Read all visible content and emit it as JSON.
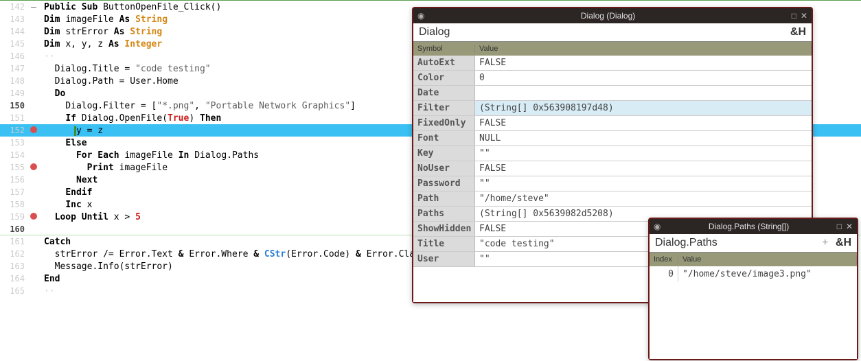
{
  "editor": {
    "lines": [
      {
        "n": "142",
        "mark": "minus",
        "tokens": [
          [
            "Public ",
            "kw-dark"
          ],
          [
            "Sub ",
            "kw-dark"
          ],
          [
            "ButtonOpenFile_Click",
            ""
          ],
          [
            "()",
            ""
          ]
        ]
      },
      {
        "n": "143",
        "tokens": [
          [
            "Dim ",
            "kw-dark"
          ],
          [
            "imageFile ",
            ""
          ],
          [
            "As ",
            "kw-dark"
          ],
          [
            "String",
            "kw-orange"
          ]
        ]
      },
      {
        "n": "144",
        "tokens": [
          [
            "Dim ",
            "kw-dark"
          ],
          [
            "strError ",
            ""
          ],
          [
            "As ",
            "kw-dark"
          ],
          [
            "String",
            "kw-orange"
          ]
        ]
      },
      {
        "n": "145",
        "tokens": [
          [
            "Dim ",
            "kw-dark"
          ],
          [
            "x, y, z ",
            ""
          ],
          [
            "As ",
            "kw-dark"
          ],
          [
            "Integer",
            "kw-orange"
          ]
        ]
      },
      {
        "n": "146",
        "tokens": [
          [
            "··",
            "dots"
          ]
        ]
      },
      {
        "n": "147",
        "tokens": [
          [
            "  Dialog.Title = ",
            ""
          ],
          [
            "\"code testing\"",
            "str"
          ]
        ]
      },
      {
        "n": "148",
        "tokens": [
          [
            "  Dialog.Path = User.Home",
            ""
          ]
        ]
      },
      {
        "n": "149",
        "tokens": [
          [
            "  ",
            ""
          ],
          [
            "Do",
            "kw-dark"
          ]
        ]
      },
      {
        "n": "150",
        "current": true,
        "tokens": [
          [
            "    Dialog.Filter = [",
            ""
          ],
          [
            "\"*.png\"",
            "str"
          ],
          [
            ", ",
            ""
          ],
          [
            "\"Portable Network Graphics\"",
            "str"
          ],
          [
            "]",
            ""
          ]
        ]
      },
      {
        "n": "151",
        "tokens": [
          [
            "    ",
            ""
          ],
          [
            "If ",
            "kw-dark"
          ],
          [
            "Dialog.OpenFile(",
            ""
          ],
          [
            "True",
            "kw-red"
          ],
          [
            ") ",
            ""
          ],
          [
            "Then",
            "kw-dark"
          ]
        ]
      },
      {
        "n": "152",
        "mark": "bp",
        "hl": true,
        "tokens": [
          [
            "      y = z",
            ""
          ]
        ]
      },
      {
        "n": "153",
        "tokens": [
          [
            "    ",
            ""
          ],
          [
            "Else",
            "kw-dark"
          ]
        ]
      },
      {
        "n": "154",
        "tokens": [
          [
            "      ",
            ""
          ],
          [
            "For Each ",
            "kw-dark"
          ],
          [
            "imageFile ",
            ""
          ],
          [
            "In ",
            "kw-dark"
          ],
          [
            "Dialog.Paths",
            ""
          ]
        ]
      },
      {
        "n": "155",
        "mark": "bp",
        "tokens": [
          [
            "        ",
            ""
          ],
          [
            "Print ",
            "kw-dark"
          ],
          [
            "imageFile",
            ""
          ]
        ]
      },
      {
        "n": "156",
        "tokens": [
          [
            "      ",
            ""
          ],
          [
            "Next",
            "kw-dark"
          ]
        ]
      },
      {
        "n": "157",
        "tokens": [
          [
            "    ",
            ""
          ],
          [
            "Endif",
            "kw-dark"
          ]
        ]
      },
      {
        "n": "158",
        "tokens": [
          [
            "    ",
            ""
          ],
          [
            "Inc ",
            "kw-dark"
          ],
          [
            "x",
            ""
          ]
        ]
      },
      {
        "n": "159",
        "mark": "bp",
        "tokens": [
          [
            "  ",
            ""
          ],
          [
            "Loop Until ",
            "kw-dark"
          ],
          [
            "x > ",
            ""
          ],
          [
            "5",
            "num"
          ]
        ]
      },
      {
        "n": "160",
        "current": true,
        "tokens": [
          [
            "",
            ""
          ]
        ],
        "border": true
      },
      {
        "n": "161",
        "tokens": [
          [
            "Catch",
            "kw-dark"
          ]
        ]
      },
      {
        "n": "162",
        "tokens": [
          [
            "  strError /= Error.Text ",
            ""
          ],
          [
            "& ",
            "kw-dark"
          ],
          [
            "Error.Where ",
            ""
          ],
          [
            "& ",
            "kw-dark"
          ],
          [
            "CStr",
            "kw-blue"
          ],
          [
            "(Error.Code) ",
            ""
          ],
          [
            "& ",
            "kw-dark"
          ],
          [
            "Error.Class.Name",
            ""
          ]
        ]
      },
      {
        "n": "163",
        "tokens": [
          [
            "  Message.Info(strError)",
            ""
          ]
        ]
      },
      {
        "n": "164",
        "tokens": [
          [
            "End",
            "kw-dark"
          ]
        ]
      },
      {
        "n": "165",
        "tokens": [
          [
            "··",
            "dots"
          ]
        ]
      }
    ]
  },
  "dialogWin": {
    "title": "Dialog (Dialog)",
    "subtitle": "Dialog",
    "hexBtn": "&H",
    "head": {
      "col1": "Symbol",
      "col2": "Value"
    },
    "rows": [
      {
        "k": "AutoExt",
        "v": "FALSE"
      },
      {
        "k": "Color",
        "v": "0"
      },
      {
        "k": "Date",
        "v": ""
      },
      {
        "k": "Filter",
        "v": "(String[] 0x563908197d48)",
        "sel": true
      },
      {
        "k": "FixedOnly",
        "v": "FALSE"
      },
      {
        "k": "Font",
        "v": "NULL"
      },
      {
        "k": "Key",
        "v": "\"\""
      },
      {
        "k": "NoUser",
        "v": "FALSE"
      },
      {
        "k": "Password",
        "v": "\"\""
      },
      {
        "k": "Path",
        "v": "\"/home/steve\""
      },
      {
        "k": "Paths",
        "v": "(String[] 0x5639082d5208)"
      },
      {
        "k": "ShowHidden",
        "v": "FALSE"
      },
      {
        "k": "Title",
        "v": "\"code testing\""
      },
      {
        "k": "User",
        "v": "\"\""
      }
    ]
  },
  "pathsWin": {
    "title": "Dialog.Paths (String[])",
    "subtitle": "Dialog.Paths",
    "hexBtn": "&H",
    "head": {
      "col1": "Index",
      "col2": "Value"
    },
    "rows": [
      {
        "idx": "0",
        "v": "\"/home/steve/image3.png\""
      }
    ]
  }
}
